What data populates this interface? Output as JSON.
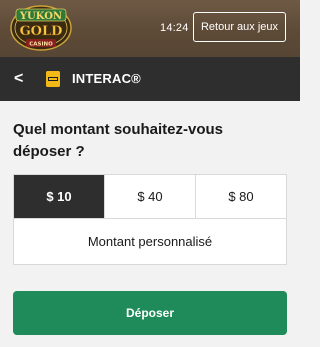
{
  "header": {
    "logo_icon": "yukon-gold-casino-logo",
    "logo_text_top": "YUKON",
    "logo_text_mid": "GOLD",
    "logo_text_bottom": "CASINO",
    "time": "14:24",
    "back_to_games_label": "Retour aux jeux"
  },
  "cashier": {
    "back_icon": "chevron-left-icon",
    "back_glyph": "<",
    "method_icon": "interac-logo-icon",
    "method_name": "INTERAC®"
  },
  "deposit": {
    "question": "Quel montant souhaitez-vous déposer ?",
    "amounts": [
      {
        "label": "$ 10",
        "selected": true
      },
      {
        "label": "$ 40",
        "selected": false
      },
      {
        "label": "$ 80",
        "selected": false
      }
    ],
    "custom_amount_label": "Montant personnalisé",
    "submit_label": "Déposer"
  },
  "colors": {
    "header_bg": "#5d4a37",
    "cashier_bar_bg": "#2e2e2e",
    "selected_amount_bg": "#2e2e2e",
    "deposit_button_bg": "#1f8a5a",
    "interac_yellow": "#f2b818",
    "page_bg": "#f2f2f2"
  }
}
